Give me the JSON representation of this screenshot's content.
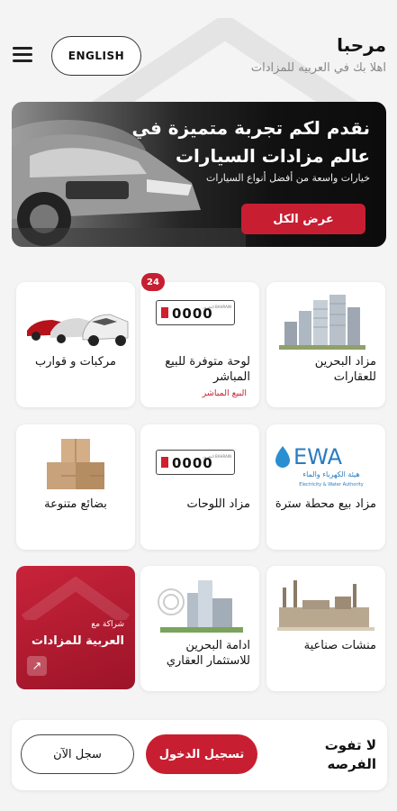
{
  "header": {
    "greeting": "مرحبا",
    "welcome": "اهلا بك في العربيه للمزادات",
    "language_button": "ENGLISH"
  },
  "banner": {
    "title": "نقدم لكم تجربة متميزة في عالم مزادات السيارات",
    "description": "خيارات واسعة من أفضل أنواع السيارات",
    "button": "عرض الكل"
  },
  "categories": [
    {
      "label": "مزاد البحرين للعقارات",
      "icon": "buildings-icon"
    },
    {
      "label": "لوحة متوفرة للبيع المباشر",
      "sublabel": "البيع المباشر",
      "badge": "24",
      "icon": "license-plate-icon",
      "plate_number": "0000",
      "plate_text": "البحرين BAHRAIN"
    },
    {
      "label": "مركبات و قوارب",
      "icon": "cars-icon"
    },
    {
      "label": "مزاد بيع محطة سترة",
      "icon": "ewa-logo",
      "logo_text": "EWA",
      "logo_ar": "هيئة الكهرباء والماء",
      "logo_en": "Electricity & Water Authority"
    },
    {
      "label": "مزاد اللوحات",
      "icon": "license-plate-icon",
      "plate_number": "0000",
      "plate_text": "البحرين BAHRAIN"
    },
    {
      "label": "بضائع متنوعة",
      "icon": "boxes-icon"
    },
    {
      "label": "منشات صناعية",
      "icon": "factory-icon"
    },
    {
      "label": "ادامة البحرين للاستثمار العقاري",
      "icon": "tower-icon"
    }
  ],
  "partner": {
    "line1": "شراكة مع",
    "line2": "العربية للمزادات"
  },
  "bottom": {
    "cta": "لا تفوت الفرصه",
    "login": "تسجيل الدخول",
    "register": "سجل الآن"
  },
  "colors": {
    "accent": "#c81e32",
    "background": "#f4f4f4"
  }
}
